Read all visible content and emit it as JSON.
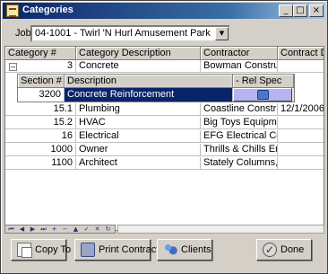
{
  "window": {
    "title": "Categories"
  },
  "job": {
    "label": "Job:",
    "value": "04-1001 - Twirl 'N Hurl Amusement Park"
  },
  "grid": {
    "columns": [
      "Category #",
      "Category Description",
      "Contractor",
      "Contract Da"
    ],
    "expanded_row": {
      "toggle": "–",
      "category_num": "3",
      "description": "Concrete",
      "contractor": "Bowman Construction",
      "contract_date": ""
    },
    "sub_grid": {
      "columns": [
        "Section #",
        "Description",
        "- Rel Spec"
      ],
      "row": {
        "section_num": "3200",
        "description": "Concrete Reinforcement"
      }
    },
    "rows": [
      {
        "category_num": "15.1",
        "description": "Plumbing",
        "contractor": "Coastline Construction",
        "contract_date": "12/1/2006"
      },
      {
        "category_num": "15.2",
        "description": "HVAC",
        "contractor": "Big Toys Equipment Re",
        "contract_date": ""
      },
      {
        "category_num": "16",
        "description": "Electrical",
        "contractor": "EFG Electrical Contract",
        "contract_date": ""
      },
      {
        "category_num": "1000",
        "description": "Owner",
        "contractor": "Thrills & Chills Entertair",
        "contract_date": ""
      },
      {
        "category_num": "1100",
        "description": "Architect",
        "contractor": "Stately Columns, Inc.",
        "contract_date": ""
      }
    ]
  },
  "navigator": {
    "icons": [
      "nav-first-icon",
      "nav-prev-icon",
      "nav-next-icon",
      "nav-last-icon",
      "nav-insert-icon",
      "nav-delete-icon",
      "nav-up-icon",
      "nav-post-icon",
      "nav-cancel-icon",
      "nav-refresh-icon"
    ]
  },
  "buttons": {
    "copy_to": "Copy To",
    "print_contracts": "Print Contracts",
    "clients": "Clients",
    "done": "Done"
  },
  "colors": {
    "title_bar": "#0a246a",
    "selection": "#0a246a",
    "rel_spec_button": "#b5b4f0"
  }
}
